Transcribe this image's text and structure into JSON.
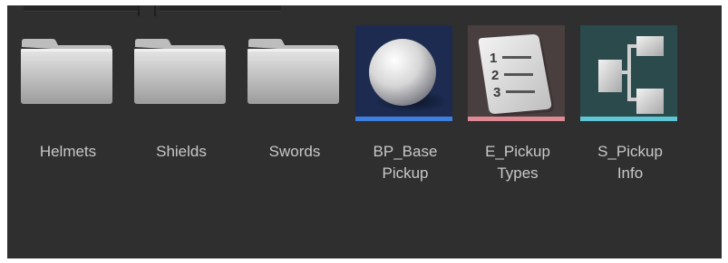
{
  "tiles": [
    {
      "id": "helmets",
      "label": "Helmets",
      "kind": "folder",
      "icon": "folder-icon"
    },
    {
      "id": "shields",
      "label": "Shields",
      "kind": "folder",
      "icon": "folder-icon"
    },
    {
      "id": "swords",
      "label": "Swords",
      "kind": "folder",
      "icon": "folder-icon"
    },
    {
      "id": "bp-base-pickup",
      "label": "BP_Base\nPickup",
      "kind": "asset",
      "icon": "sphere-icon",
      "bg": "#1c2b4f",
      "bar": "#3f7fe0"
    },
    {
      "id": "e-pickup-types",
      "label": "E_Pickup\nTypes",
      "kind": "asset",
      "icon": "numbered-list-icon",
      "bg": "#4a3f3f",
      "bar": "#e08a96"
    },
    {
      "id": "s-pickup-info",
      "label": "S_Pickup\nInfo",
      "kind": "asset",
      "icon": "struct-diagram-icon",
      "bg": "#2a4a4c",
      "bar": "#5fc6d6"
    }
  ]
}
